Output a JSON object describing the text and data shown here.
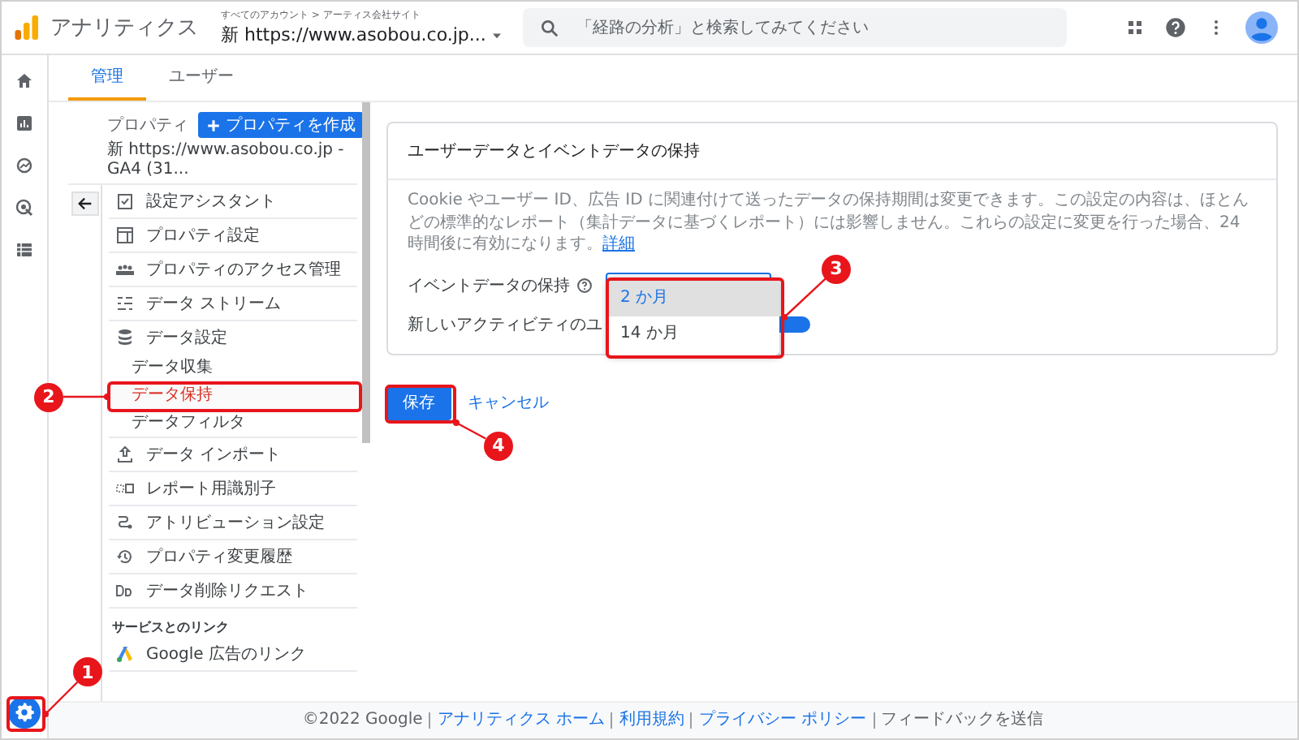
{
  "header": {
    "product": "アナリティクス",
    "breadcrumb": "すべてのアカウント > アーティス会社サイト",
    "property": "新 https://www.asobou.co.jp...",
    "search": {
      "placeholder": "「経路の分析」と検索してみてください"
    }
  },
  "tabs": [
    {
      "label": "管理",
      "selected": true
    },
    {
      "label": "ユーザー",
      "selected": false
    }
  ],
  "property_panel": {
    "label": "プロパティ",
    "create_button": "プロパティを作成",
    "property_name": "新 https://www.asobou.co.jp - GA4 (31..."
  },
  "nav": {
    "items": [
      {
        "label": "設定アシスタント",
        "selected": false
      },
      {
        "label": "プロパティ設定",
        "selected": false
      },
      {
        "label": "プロパティのアクセス管理",
        "selected": false
      },
      {
        "label": "データ ストリーム",
        "selected": false
      },
      {
        "label": "データ設定",
        "selected": false,
        "children": [
          {
            "label": "データ収集",
            "selected": false
          },
          {
            "label": "データ保持",
            "selected": true
          },
          {
            "label": "データフィルタ",
            "selected": false
          }
        ]
      },
      {
        "label": "データ インポート",
        "selected": false
      },
      {
        "label": "レポート用識別子",
        "selected": false
      },
      {
        "label": "アトリビューション設定",
        "selected": false
      },
      {
        "label": "プロパティ変更履歴",
        "selected": false
      },
      {
        "label": "データ削除リクエスト",
        "selected": false
      }
    ],
    "section_title": "サービスとのリンク",
    "links": [
      {
        "label": "Google 広告のリンク"
      }
    ]
  },
  "card": {
    "title": "ユーザーデータとイベントデータの保持",
    "description": "Cookie やユーザー ID、広告 ID に関連付けて送ったデータの保持期間は変更できます。この設定の内容は、ほとんどの標準的なレポート（集計データに基づくレポート）には影響しません。これらの設定に変更を行った場合、24 時間後に有効になります。",
    "link": "詳細",
    "fields": [
      {
        "label": "イベントデータの保持",
        "kind": "select",
        "help": true
      },
      {
        "label": "新しいアクティビティのユ",
        "kind": "toggle",
        "on": true
      }
    ]
  },
  "dropdown": {
    "options": [
      {
        "label": "2 か月",
        "selected": true
      },
      {
        "label": "14 か月",
        "selected": false
      }
    ]
  },
  "actions": {
    "save": "保存",
    "cancel": "キャンセル"
  },
  "footer": {
    "copyright": "©2022 Google",
    "links": [
      "アナリティクス ホーム",
      "利用規約",
      "プライバシー ポリシー"
    ],
    "feedback": "フィードバックを送信"
  },
  "annotations": [
    {
      "number": "1"
    },
    {
      "number": "2"
    },
    {
      "number": "3"
    },
    {
      "number": "4"
    }
  ]
}
